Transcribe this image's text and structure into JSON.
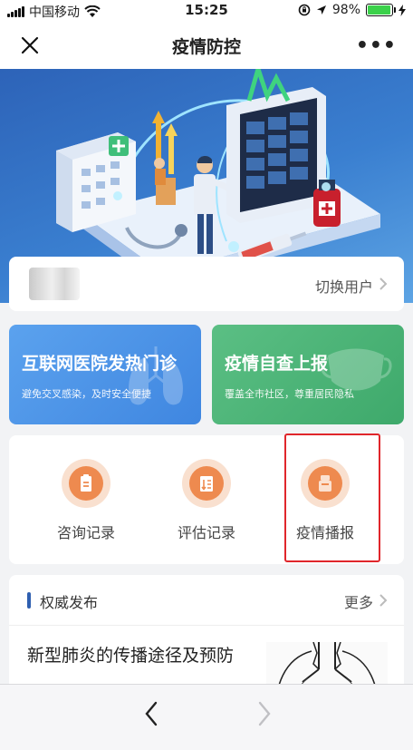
{
  "status_bar": {
    "carrier": "中国移动",
    "time": "15:25",
    "battery_percent_label": "98%",
    "battery_level": 0.98
  },
  "nav": {
    "title": "疫情防控"
  },
  "user": {
    "switch_label": "切换用户"
  },
  "cards": [
    {
      "title": "互联网医院发热门诊",
      "subtitle": "避免交叉感染，及时安全便捷",
      "color": "#4a93e8"
    },
    {
      "title": "疫情自查上报",
      "subtitle": "覆盖全市社区，尊重居民隐私",
      "color": "#4db477"
    }
  ],
  "tools": [
    {
      "label": "咨询记录",
      "icon": "clipboard-icon"
    },
    {
      "label": "评估记录",
      "icon": "list-icon"
    },
    {
      "label": "疫情播报",
      "icon": "broadcast-icon"
    }
  ],
  "highlight_color": "#e0262b",
  "news": {
    "section_title": "权威发布",
    "more_label": "更多",
    "article_title": "新型肺炎的传播途径及预防"
  }
}
